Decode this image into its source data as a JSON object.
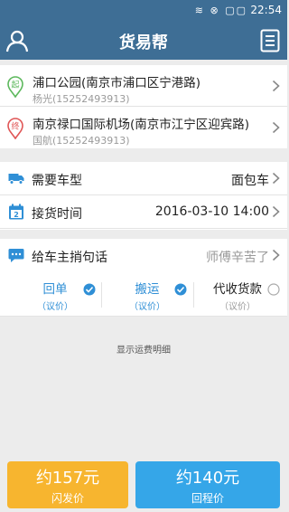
{
  "status_bar": {
    "icons": "≋ ⊗ ▢▢",
    "time": "22:54"
  },
  "header": {
    "title": "货易帮"
  },
  "route": {
    "start": {
      "badge": "起",
      "name": "浦口公园(南京市浦口区宁港路)",
      "contact": "杨光(15252493913)"
    },
    "end": {
      "badge": "终",
      "name": "南京禄口国际机场(南京市江宁区迎宾路)",
      "contact": "国航(15252493913)"
    }
  },
  "options": {
    "vehicle": {
      "label": "需要车型",
      "value": "面包车"
    },
    "pickup_time": {
      "label": "接货时间",
      "value": "2016-03-10 14:00",
      "calendar_day": "2"
    },
    "message": {
      "label": "给车主捎句话",
      "value": "师傅辛苦了"
    }
  },
  "extras": {
    "return_receipt": {
      "name": "回单",
      "note": "（议价）",
      "checked": true
    },
    "carry": {
      "name": "搬运",
      "note": "（议价）",
      "checked": true
    },
    "cod": {
      "name": "代收货款",
      "note": "（议价）",
      "checked": false
    }
  },
  "fee_detail_link": "显示运费明细",
  "prices": {
    "flash": {
      "price": "约157元",
      "label": "闪发价"
    },
    "return_trip": {
      "price": "约140元",
      "label": "回程价"
    }
  },
  "colors": {
    "header": "#3e6e95",
    "accent_blue": "#2f8fd6",
    "flash_button": "#f7b52f",
    "return_button": "#35a6e8",
    "start_pin": "#5cb85c",
    "end_pin": "#e05555"
  }
}
